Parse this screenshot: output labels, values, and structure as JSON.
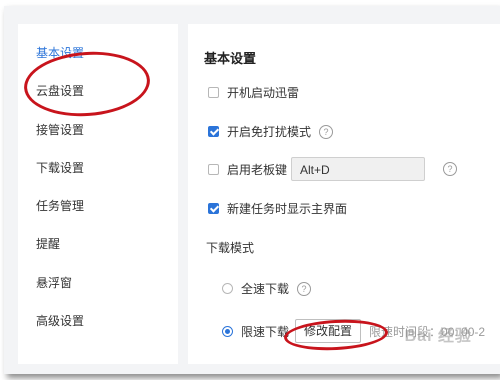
{
  "sidebar": {
    "items": [
      {
        "label": "基本设置",
        "active": true
      },
      {
        "label": "云盘设置"
      },
      {
        "label": "接管设置"
      },
      {
        "label": "下载设置"
      },
      {
        "label": "任务管理"
      },
      {
        "label": "提醒"
      },
      {
        "label": "悬浮窗"
      },
      {
        "label": "高级设置"
      }
    ]
  },
  "main": {
    "title": "基本设置",
    "options": {
      "autostart": {
        "label": "开机启动迅雷",
        "checked": false
      },
      "do_not_disturb": {
        "label": "开启免打扰模式",
        "checked": true
      },
      "boss_key": {
        "label": "启用老板键",
        "checked": false,
        "hotkey": "Alt+D"
      },
      "show_main_on_new": {
        "label": "新建任务时显示主界面",
        "checked": true
      }
    },
    "download_mode": {
      "title": "下载模式",
      "full_speed": {
        "label": "全速下载",
        "selected": false
      },
      "limited": {
        "label": "限速下载",
        "selected": true,
        "button_label": "修改配置",
        "time_label": "限速时间段：00: 00-2"
      }
    }
  },
  "watermark": "Bai 经验",
  "colors": {
    "accent": "#2b74d9",
    "annotation": "#c8141c"
  },
  "icons": {
    "help": "?"
  }
}
